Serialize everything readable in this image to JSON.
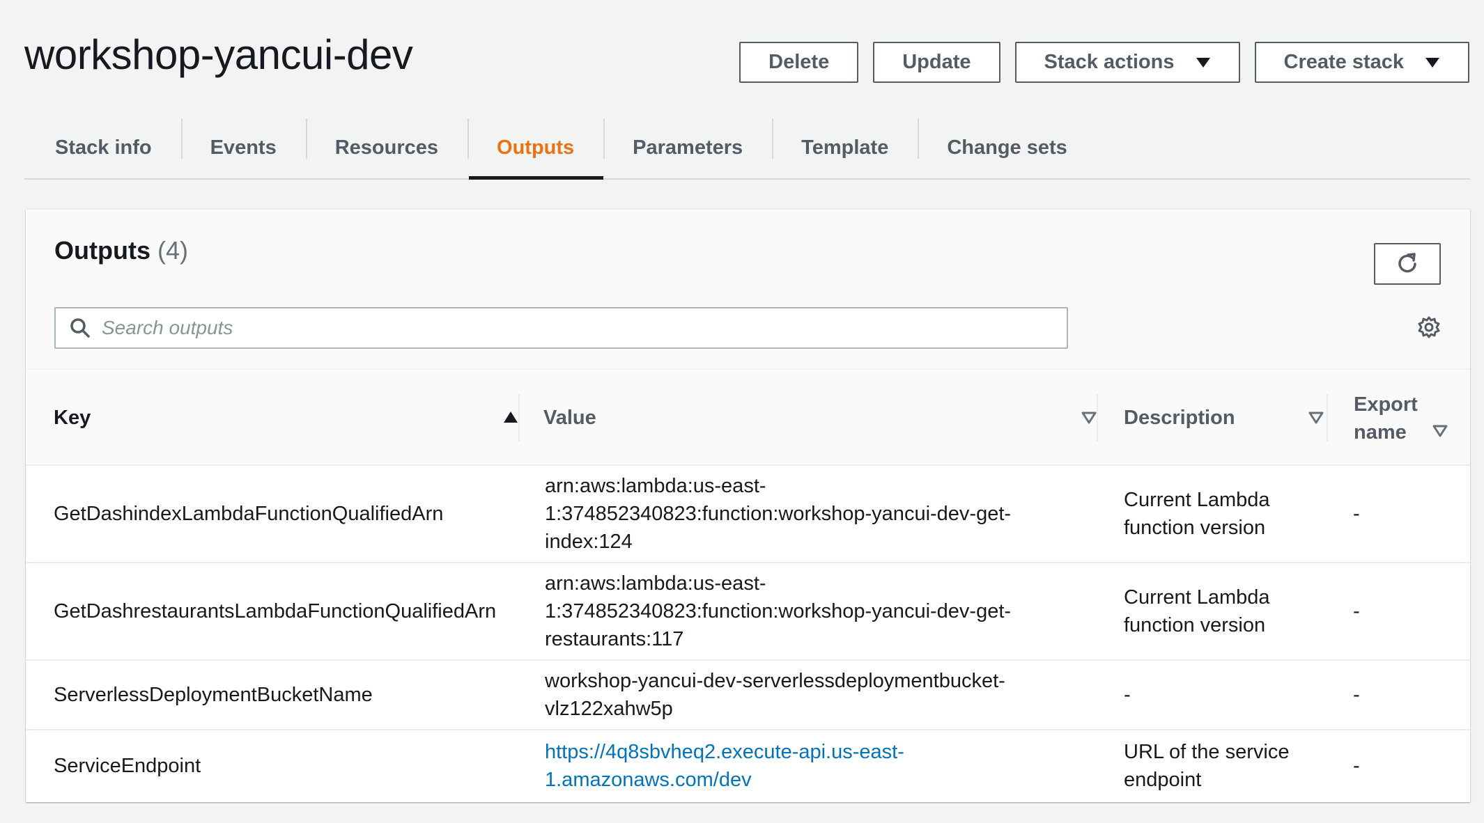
{
  "header": {
    "title": "workshop-yancui-dev",
    "actions": {
      "delete": "Delete",
      "update": "Update",
      "stack_actions": "Stack actions",
      "create_stack": "Create stack"
    }
  },
  "tabs": [
    {
      "label": "Stack info",
      "active": false
    },
    {
      "label": "Events",
      "active": false
    },
    {
      "label": "Resources",
      "active": false
    },
    {
      "label": "Outputs",
      "active": true
    },
    {
      "label": "Parameters",
      "active": false
    },
    {
      "label": "Template",
      "active": false
    },
    {
      "label": "Change sets",
      "active": false
    }
  ],
  "outputs": {
    "title": "Outputs",
    "count": "(4)",
    "search_placeholder": "Search outputs",
    "columns": {
      "key": "Key",
      "value": "Value",
      "description": "Description",
      "export_name_line1": "Export",
      "export_name_line2": "name"
    },
    "rows": [
      {
        "key": "GetDashindexLambdaFunctionQualifiedArn",
        "value_lines": [
          "arn:aws:lambda:us-east-",
          "1:374852340823:function:workshop-yancui-dev-get-",
          "index:124"
        ],
        "description_lines": [
          "Current Lambda",
          "function version"
        ],
        "export_name": "-"
      },
      {
        "key": "GetDashrestaurantsLambdaFunctionQualifiedArn",
        "value_lines": [
          "arn:aws:lambda:us-east-",
          "1:374852340823:function:workshop-yancui-dev-get-",
          "restaurants:117"
        ],
        "description_lines": [
          "Current Lambda",
          "function version"
        ],
        "export_name": "-"
      },
      {
        "key": "ServerlessDeploymentBucketName",
        "value_lines": [
          "workshop-yancui-dev-serverlessdeploymentbucket-",
          "vlz122xahw5p"
        ],
        "description_lines": [
          "-"
        ],
        "export_name": "-"
      },
      {
        "key": "ServiceEndpoint",
        "value_lines": [
          "https://4q8sbvheq2.execute-api.us-east-",
          "1.amazonaws.com/dev"
        ],
        "description_lines": [
          "URL of the service",
          "endpoint"
        ],
        "export_name": "-"
      }
    ]
  },
  "icons": {
    "refresh": "refresh-icon",
    "search": "search-icon",
    "settings": "gear-icon",
    "sort_asc": "sort-ascending-icon",
    "sort_none": "sort-descending-outline-icon",
    "dropdown": "caret-down-icon"
  },
  "colors": {
    "accent_tab": "#ec7211",
    "link": "#0073bb"
  }
}
